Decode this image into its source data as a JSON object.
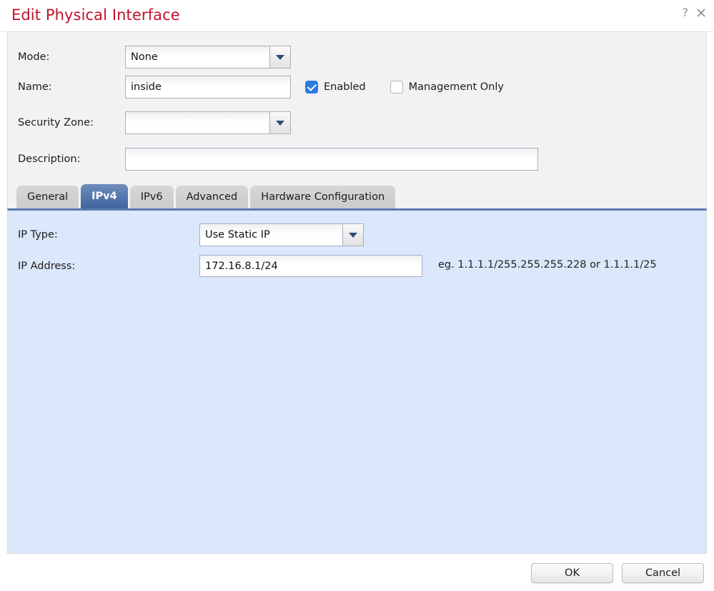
{
  "window": {
    "title": "Edit Physical Interface",
    "help_icon": "question-mark-icon",
    "close_icon": "close-icon"
  },
  "form": {
    "mode": {
      "label": "Mode:",
      "value": "None"
    },
    "name": {
      "label": "Name:",
      "value": "inside",
      "placeholder": ""
    },
    "enabled": {
      "label": "Enabled",
      "checked": true
    },
    "management_only": {
      "label": "Management Only",
      "checked": false
    },
    "security_zone": {
      "label": "Security Zone:",
      "value": ""
    },
    "description": {
      "label": "Description:",
      "value": "",
      "placeholder": ""
    }
  },
  "tabs": [
    {
      "label": "General",
      "active": false
    },
    {
      "label": "IPv4",
      "active": true
    },
    {
      "label": "IPv6",
      "active": false
    },
    {
      "label": "Advanced",
      "active": false
    },
    {
      "label": "Hardware Configuration",
      "active": false
    }
  ],
  "ipv4": {
    "ip_type": {
      "label": "IP Type:",
      "value": "Use Static IP"
    },
    "ip_address": {
      "label": "IP Address:",
      "value": "172.16.8.1/24",
      "placeholder": ""
    },
    "hint": "eg. 1.1.1.1/255.255.255.228 or 1.1.1.1/25"
  },
  "footer": {
    "ok_label": "OK",
    "cancel_label": "Cancel"
  },
  "colors": {
    "title_red": "#c2112e",
    "accent_blue": "#41649e",
    "panel_blue": "#dbe7fa",
    "checkbox_blue": "#2b7ae4"
  }
}
